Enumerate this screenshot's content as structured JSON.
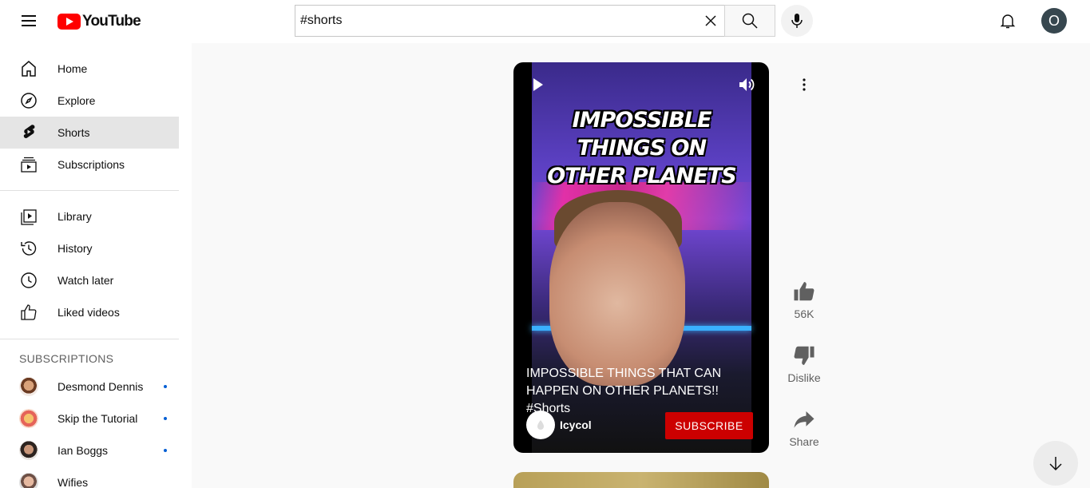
{
  "header": {
    "logo_text": "YouTube",
    "search_value": "#shorts",
    "avatar_letter": "O"
  },
  "sidebar": {
    "primary": [
      {
        "label": "Home",
        "icon": "home-icon"
      },
      {
        "label": "Explore",
        "icon": "compass-icon"
      },
      {
        "label": "Shorts",
        "icon": "shorts-icon",
        "active": true
      },
      {
        "label": "Subscriptions",
        "icon": "subscriptions-icon"
      }
    ],
    "library": [
      {
        "label": "Library",
        "icon": "library-icon"
      },
      {
        "label": "History",
        "icon": "history-icon"
      },
      {
        "label": "Watch later",
        "icon": "clock-icon"
      },
      {
        "label": "Liked videos",
        "icon": "thumb-up-icon"
      }
    ],
    "subscriptions_title": "SUBSCRIPTIONS",
    "subscriptions": [
      {
        "label": "Desmond Dennis",
        "new": true
      },
      {
        "label": "Skip the Tutorial",
        "new": true
      },
      {
        "label": "Ian Boggs",
        "new": true
      },
      {
        "label": "Wifies",
        "new": false
      }
    ]
  },
  "short": {
    "thumbnail_title": "IMPOSSIBLE THINGS ON OTHER PLANETS",
    "caption": "IMPOSSIBLE THINGS THAT CAN HAPPEN ON OTHER PLANETS!! #Shorts",
    "channel": "Icycol",
    "subscribe_label": "SUBSCRIBE"
  },
  "actions": {
    "like_count": "56K",
    "dislike_label": "Dislike",
    "share_label": "Share"
  },
  "colors": {
    "brand_red": "#ff0000",
    "subscribe_red": "#cc0000",
    "new_dot": "#065fd4"
  }
}
